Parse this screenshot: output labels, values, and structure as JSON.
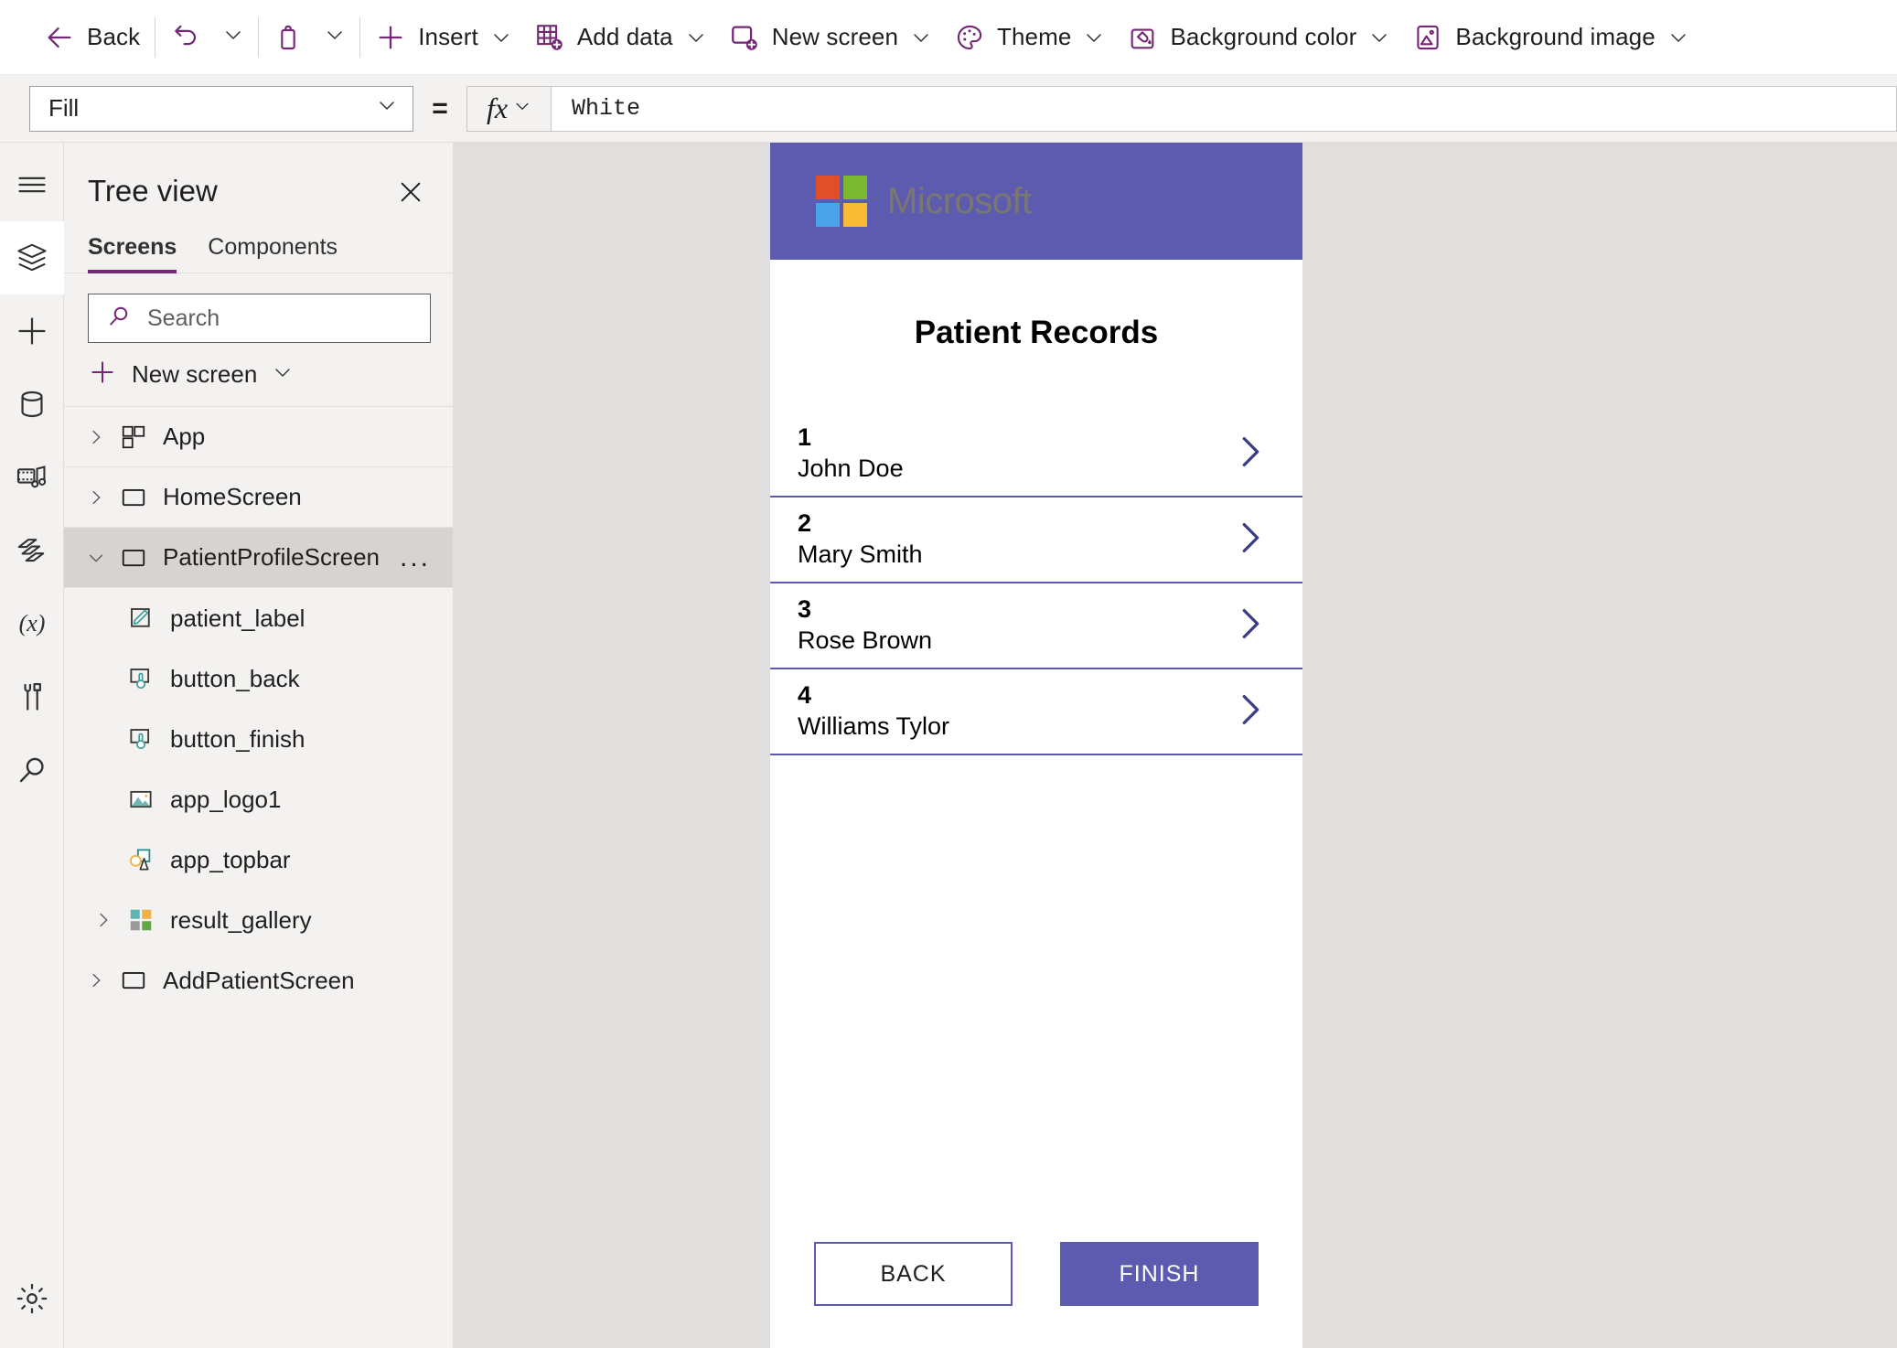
{
  "toolbar": {
    "back_label": "Back",
    "undo_icon": "undo-icon",
    "undo_caret": "chevron-down-icon",
    "paste_icon": "clipboard-icon",
    "paste_caret": "chevron-down-icon",
    "insert_label": "Insert",
    "add_data_label": "Add data",
    "new_screen_label": "New screen",
    "theme_label": "Theme",
    "background_color_label": "Background color",
    "background_image_label": "Background image"
  },
  "formula_bar": {
    "property": "Fill",
    "equals": "=",
    "fx_label": "fx",
    "value": "White"
  },
  "rail": {
    "items": [
      {
        "name": "hamburger-menu-icon",
        "active": false
      },
      {
        "name": "tree-view-icon",
        "active": true
      },
      {
        "name": "insert-icon",
        "active": false
      },
      {
        "name": "data-icon",
        "active": false
      },
      {
        "name": "media-icon",
        "active": false
      },
      {
        "name": "power-automate-icon",
        "active": false
      },
      {
        "name": "variables-icon",
        "active": false
      },
      {
        "name": "advanced-tools-icon",
        "active": false
      },
      {
        "name": "search-icon",
        "active": false
      }
    ],
    "settings_icon": "gear-icon"
  },
  "tree_view": {
    "title": "Tree view",
    "close_icon": "close-icon",
    "tabs": [
      {
        "label": "Screens",
        "active": true
      },
      {
        "label": "Components",
        "active": false
      }
    ],
    "search_placeholder": "Search",
    "new_screen_label": "New screen",
    "nodes": [
      {
        "label": "App",
        "icon": "app-icon",
        "level": 1,
        "expanded": false,
        "has_chevron": true,
        "selected": false
      },
      {
        "label": "HomeScreen",
        "icon": "screen-icon",
        "level": 1,
        "expanded": false,
        "has_chevron": true,
        "selected": false
      },
      {
        "label": "PatientProfileScreen",
        "icon": "screen-icon",
        "level": 1,
        "expanded": true,
        "has_chevron": true,
        "selected": true,
        "overflow": "..."
      },
      {
        "label": "patient_label",
        "icon": "label-icon",
        "level": 2,
        "has_chevron": false,
        "selected": false
      },
      {
        "label": "button_back",
        "icon": "button-icon",
        "level": 2,
        "has_chevron": false,
        "selected": false
      },
      {
        "label": "button_finish",
        "icon": "button-icon",
        "level": 2,
        "has_chevron": false,
        "selected": false
      },
      {
        "label": "app_logo1",
        "icon": "image-icon",
        "level": 2,
        "has_chevron": false,
        "selected": false
      },
      {
        "label": "app_topbar",
        "icon": "shapes-icon",
        "level": 2,
        "has_chevron": false,
        "selected": false
      },
      {
        "label": "result_gallery",
        "icon": "gallery-icon",
        "level": 2,
        "has_chevron": true,
        "expanded": false,
        "selected": false
      },
      {
        "label": "AddPatientScreen",
        "icon": "screen-icon",
        "level": 1,
        "has_chevron": true,
        "expanded": false,
        "selected": false
      }
    ]
  },
  "canvas": {
    "app_topbar": {
      "logo_name": "microsoft-logo-icon",
      "brand_text": "Microsoft",
      "background_color": "#5c5bb0",
      "logo_colors": [
        "#e14f28",
        "#7cb82f",
        "#4aa3e8",
        "#f7ba33"
      ]
    },
    "screen_title": "Patient Records",
    "gallery_rows": [
      {
        "number": "1",
        "name": "John Doe",
        "arrow_icon": "chevron-right-icon"
      },
      {
        "number": "2",
        "name": "Mary Smith",
        "arrow_icon": "chevron-right-icon"
      },
      {
        "number": "3",
        "name": "Rose Brown",
        "arrow_icon": "chevron-right-icon"
      },
      {
        "number": "4",
        "name": "Williams Tylor",
        "arrow_icon": "chevron-right-icon"
      }
    ],
    "buttons": {
      "back": "BACK",
      "finish": "FINISH"
    }
  },
  "colors": {
    "accent_purple": "#742774",
    "app_indigo": "#5c5bb0",
    "selected_row": "#d6d3d1"
  }
}
